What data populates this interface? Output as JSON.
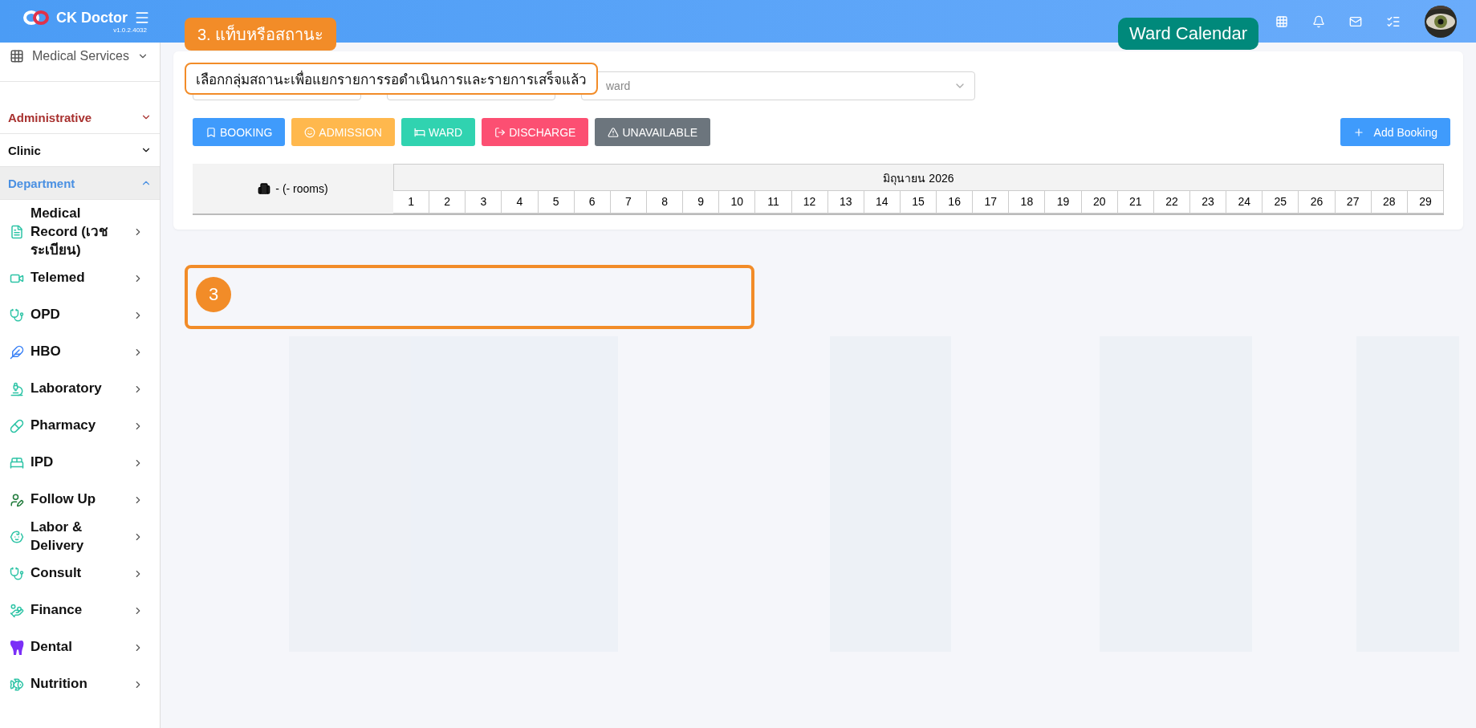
{
  "header": {
    "brand": "CK Doctor",
    "version": "v1.0.2.4032"
  },
  "sidebar": {
    "module": "Medical Services",
    "sections": [
      {
        "label": "Administrative",
        "expanded": false,
        "color": "#a8312f"
      },
      {
        "label": "Clinic",
        "expanded": false,
        "color": "#111111"
      },
      {
        "label": "Department",
        "expanded": true,
        "color": "#4a90e2"
      }
    ],
    "items": [
      {
        "label": "Medical Record (เวชระเบียน)"
      },
      {
        "label": "Telemed"
      },
      {
        "label": "OPD"
      },
      {
        "label": "HBO"
      },
      {
        "label": "Laboratory"
      },
      {
        "label": "Pharmacy"
      },
      {
        "label": "IPD"
      },
      {
        "label": "Follow Up"
      },
      {
        "label": "Labor & Delivery"
      },
      {
        "label": "Consult"
      },
      {
        "label": "Finance"
      },
      {
        "label": "Dental"
      },
      {
        "label": "Nutrition"
      }
    ]
  },
  "ward_filter": {
    "placeholder": "ward"
  },
  "legend": [
    {
      "label": "BOOKING",
      "color": "#3f9bfc"
    },
    {
      "label": "ADMISSION",
      "color": "#ffb84d"
    },
    {
      "label": "WARD",
      "color": "#30d3b0"
    },
    {
      "label": "DISCHARGE",
      "color": "#fc4f72"
    },
    {
      "label": "UNAVAILABLE",
      "color": "#6c757d"
    }
  ],
  "add_button": "Add Booking",
  "calendar": {
    "rooms": "- (- rooms)",
    "month": "มิถุนายน 2026",
    "days": [
      "1",
      "2",
      "3",
      "4",
      "5",
      "6",
      "7",
      "8",
      "9",
      "10",
      "11",
      "12",
      "13",
      "14",
      "15",
      "16",
      "17",
      "18",
      "19",
      "20",
      "21",
      "22",
      "23",
      "24",
      "25",
      "26",
      "27",
      "28",
      "29"
    ]
  },
  "annotations": {
    "step_label": "3. แท็บหรือสถานะ",
    "tooltip": "เลือกกลุ่มสถานะเพื่อแยกรายการรอดำเนินการและรายการเสร็จแล้ว",
    "page_badge": "Ward Calendar",
    "marker": "3"
  }
}
